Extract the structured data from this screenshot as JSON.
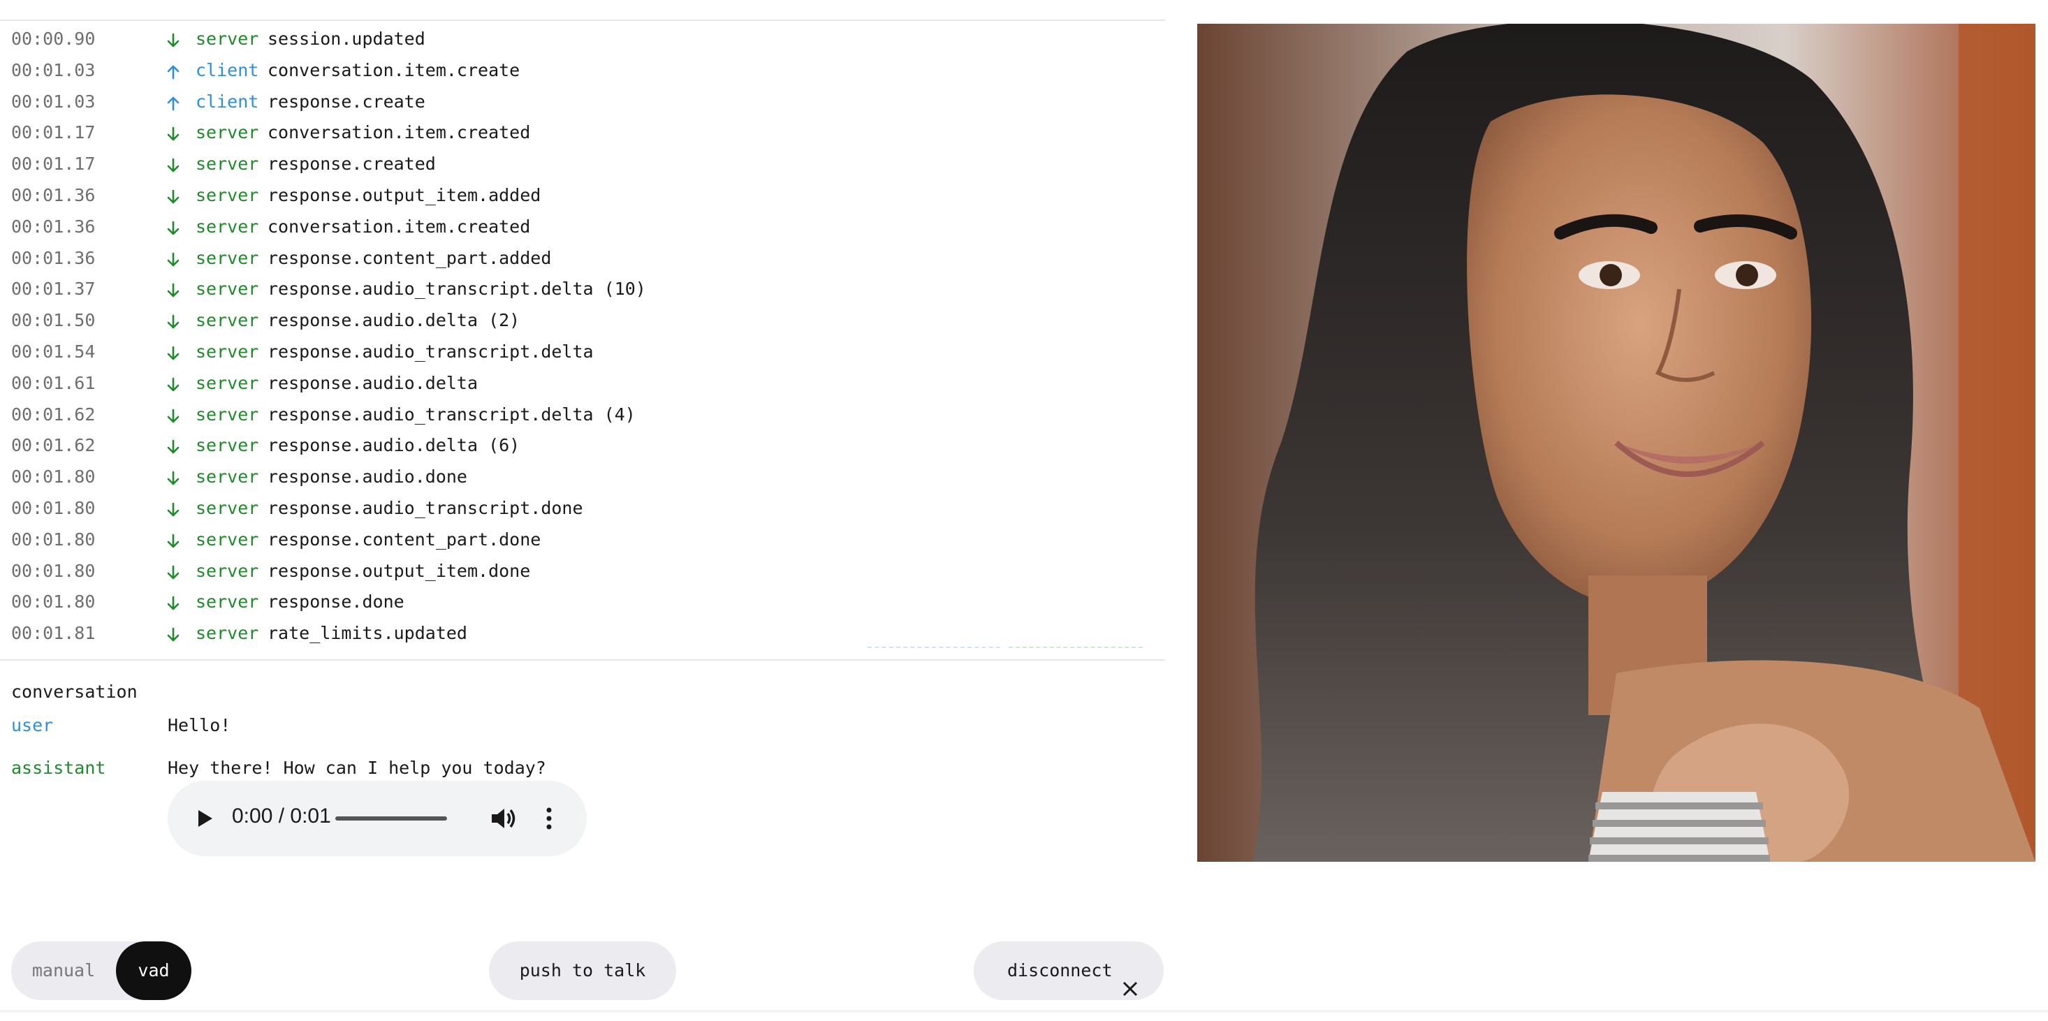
{
  "events": [
    {
      "time": "00:00.90",
      "source": "server",
      "type": "session.updated"
    },
    {
      "time": "00:01.03",
      "source": "client",
      "type": "conversation.item.create"
    },
    {
      "time": "00:01.03",
      "source": "client",
      "type": "response.create"
    },
    {
      "time": "00:01.17",
      "source": "server",
      "type": "conversation.item.created"
    },
    {
      "time": "00:01.17",
      "source": "server",
      "type": "response.created"
    },
    {
      "time": "00:01.36",
      "source": "server",
      "type": "response.output_item.added"
    },
    {
      "time": "00:01.36",
      "source": "server",
      "type": "conversation.item.created"
    },
    {
      "time": "00:01.36",
      "source": "server",
      "type": "response.content_part.added"
    },
    {
      "time": "00:01.37",
      "source": "server",
      "type": "response.audio_transcript.delta (10)"
    },
    {
      "time": "00:01.50",
      "source": "server",
      "type": "response.audio.delta (2)"
    },
    {
      "time": "00:01.54",
      "source": "server",
      "type": "response.audio_transcript.delta"
    },
    {
      "time": "00:01.61",
      "source": "server",
      "type": "response.audio.delta"
    },
    {
      "time": "00:01.62",
      "source": "server",
      "type": "response.audio_transcript.delta (4)"
    },
    {
      "time": "00:01.62",
      "source": "server",
      "type": "response.audio.delta (6)"
    },
    {
      "time": "00:01.80",
      "source": "server",
      "type": "response.audio.done"
    },
    {
      "time": "00:01.80",
      "source": "server",
      "type": "response.audio_transcript.done"
    },
    {
      "time": "00:01.80",
      "source": "server",
      "type": "response.content_part.done"
    },
    {
      "time": "00:01.80",
      "source": "server",
      "type": "response.output_item.done"
    },
    {
      "time": "00:01.80",
      "source": "server",
      "type": "response.done"
    },
    {
      "time": "00:01.81",
      "source": "server",
      "type": "rate_limits.updated"
    }
  ],
  "colors": {
    "server": "#1f8a2a",
    "client": "#2f8fdd",
    "vad_active_bg": "#101010"
  },
  "conversation": {
    "title": "conversation",
    "messages": [
      {
        "role": "user",
        "text": "Hello!"
      },
      {
        "role": "assistant",
        "text": "Hey there! How can I help you today?"
      }
    ],
    "audio": {
      "time": "0:00 / 0:01",
      "progress": 0
    }
  },
  "controls": {
    "mode_manual": "manual",
    "mode_vad": "vad",
    "active_mode": "vad",
    "push_to_talk": "push to talk",
    "disconnect": "disconnect"
  },
  "icons": {
    "server_arrow": "arrow-down-icon",
    "client_arrow": "arrow-up-icon",
    "play": "play-icon",
    "volume": "volume-icon",
    "more": "more-vertical-icon",
    "close": "close-icon"
  }
}
